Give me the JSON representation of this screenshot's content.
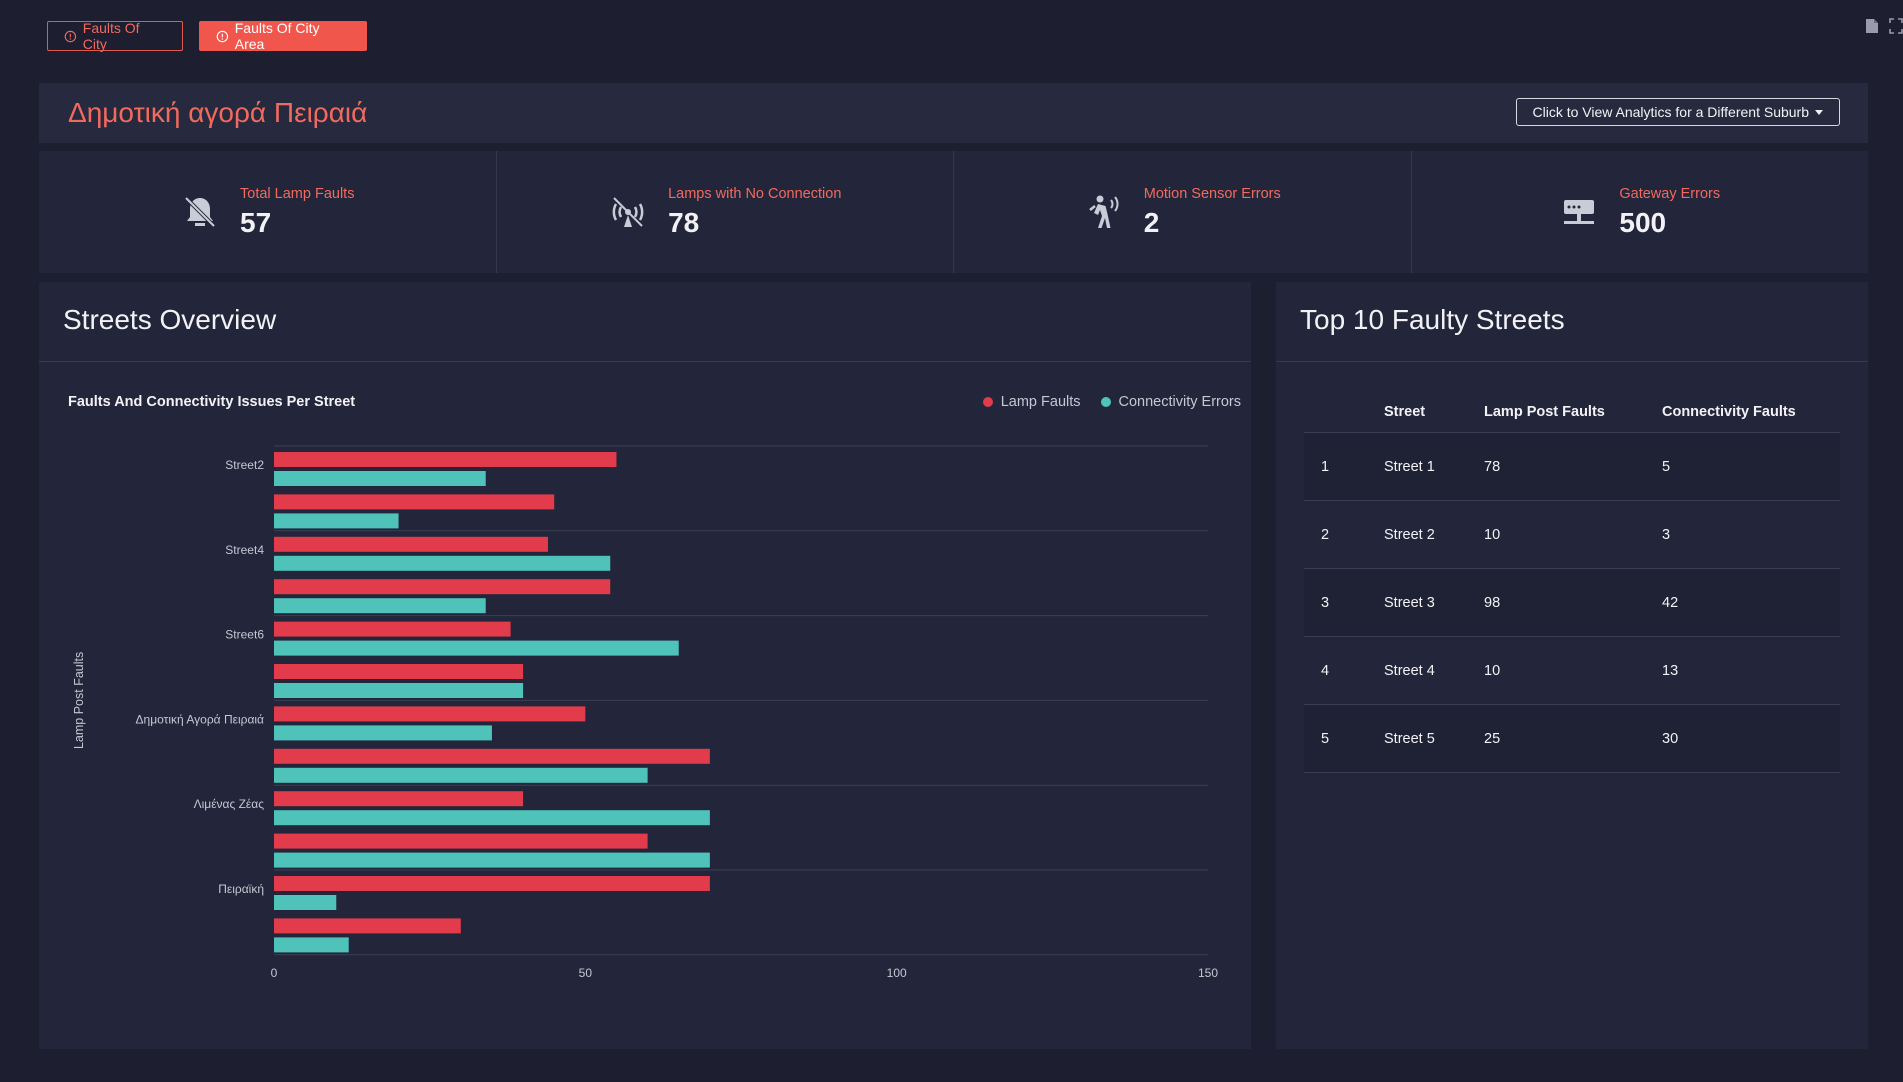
{
  "top_buttons": [
    {
      "label": "Faults Of City"
    },
    {
      "label": "Faults Of City Area"
    }
  ],
  "header": {
    "title": "Δημοτική αγορά Πειραιά",
    "suburb_button": "Click to View Analytics for a Different Suburb"
  },
  "stats": [
    {
      "label": "Total Lamp Faults",
      "value": "57",
      "icon": "lamp-fault-icon"
    },
    {
      "label": "Lamps with No Connection",
      "value": "78",
      "icon": "no-connection-icon"
    },
    {
      "label": "Motion Sensor Errors",
      "value": "2",
      "icon": "motion-sensor-icon"
    },
    {
      "label": "Gateway Errors",
      "value": "500",
      "icon": "gateway-icon"
    }
  ],
  "streets_card": {
    "title": "Streets Overview"
  },
  "chart_data": {
    "type": "bar",
    "orientation": "horizontal",
    "title": "Faults And Connectivity Issues Per Street",
    "ylabel": "Lamp Post Faults",
    "xlabel": "",
    "xlim": [
      0,
      150
    ],
    "xticks": [
      0,
      50,
      100,
      150
    ],
    "category_labels": [
      "Street2",
      "",
      "Street4",
      "",
      "Street6",
      "",
      "Δημοτική Αγορά Πειραιά",
      "",
      "Λιμένας Ζέας",
      "",
      "Πειραϊκή",
      ""
    ],
    "series": [
      {
        "name": "Lamp Faults",
        "color": "#e23b4b",
        "values": [
          55,
          45,
          44,
          54,
          38,
          40,
          50,
          70,
          40,
          60,
          70,
          30
        ]
      },
      {
        "name": "Connectivity Errors",
        "color": "#4fc3ba",
        "values": [
          34,
          20,
          54,
          34,
          65,
          40,
          35,
          60,
          70,
          70,
          10,
          12
        ]
      }
    ],
    "legend_position": "top-right",
    "grid": "horizontal"
  },
  "top10": {
    "title": "Top 10 Faulty Streets",
    "columns": [
      "Street",
      "Lamp Post Faults",
      "Connectivity Faults"
    ],
    "rows": [
      {
        "rank": "1",
        "street": "Street 1",
        "lamp": "78",
        "conn": "5"
      },
      {
        "rank": "2",
        "street": "Street 2",
        "lamp": "10",
        "conn": "3"
      },
      {
        "rank": "3",
        "street": "Street 3",
        "lamp": "98",
        "conn": "42"
      },
      {
        "rank": "4",
        "street": "Street 4",
        "lamp": "10",
        "conn": "13"
      },
      {
        "rank": "5",
        "street": "Street 5",
        "lamp": "25",
        "conn": "30"
      }
    ]
  }
}
